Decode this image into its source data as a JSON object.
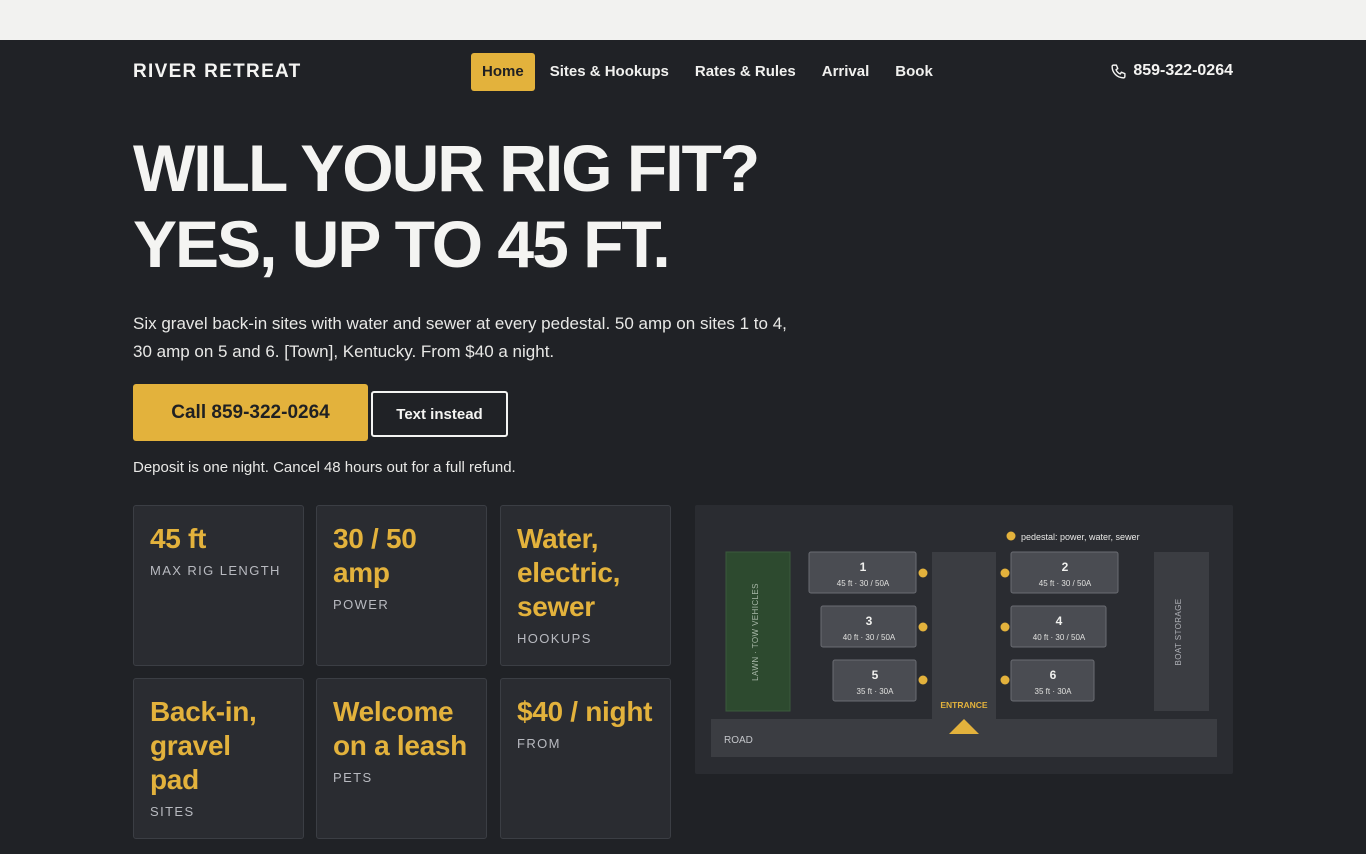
{
  "brand": "RIVER RETREAT",
  "nav": {
    "items": [
      "Home",
      "Sites & Hookups",
      "Rates & Rules",
      "Arrival",
      "Book"
    ],
    "active": "Home",
    "phone": "859-322-0264",
    "phone_icon": "phone-icon"
  },
  "hero": {
    "title_line1": "WILL YOUR RIG FIT?",
    "title_line2": "YES, UP TO 45 FT.",
    "lead": "Six gravel back-in sites with water and sewer at every pedestal. 50 amp on sites 1 to 4, 30 amp on 5 and 6. [Town], Kentucky. From $40 a night.",
    "call_button": "Call 859-322-0264",
    "text_button": "Text instead",
    "note": "Deposit is one night. Cancel 48 hours out for a full refund."
  },
  "features": [
    {
      "value": "45 ft",
      "label": "MAX RIG LENGTH"
    },
    {
      "value": "30 / 50 amp",
      "label": "POWER"
    },
    {
      "value": "Water, electric, sewer",
      "label": "HOOKUPS"
    },
    {
      "value": "Back-in, gravel pad",
      "label": "SITES"
    },
    {
      "value": "Welcome on a leash",
      "label": "PETS"
    },
    {
      "value": "$40 / night",
      "label": "FROM"
    }
  ],
  "site_map": {
    "legend": "pedestal: power, water, sewer",
    "lawn_label": "LAWN · TOW VEHICLES",
    "storage_label": "BOAT STORAGE",
    "road_label": "ROAD",
    "entrance_label": "ENTRANCE",
    "sites": [
      {
        "num": "1",
        "detail": "45 ft · 30 / 50A"
      },
      {
        "num": "2",
        "detail": "45 ft · 30 / 50A"
      },
      {
        "num": "3",
        "detail": "40 ft · 30 / 50A"
      },
      {
        "num": "4",
        "detail": "40 ft · 30 / 50A"
      },
      {
        "num": "5",
        "detail": "35 ft · 30A"
      },
      {
        "num": "6",
        "detail": "35 ft · 30A"
      }
    ]
  },
  "colors": {
    "accent": "#e3b23c",
    "background": "#202226",
    "card": "#2a2c31",
    "lawn": "#2d4a2f"
  }
}
